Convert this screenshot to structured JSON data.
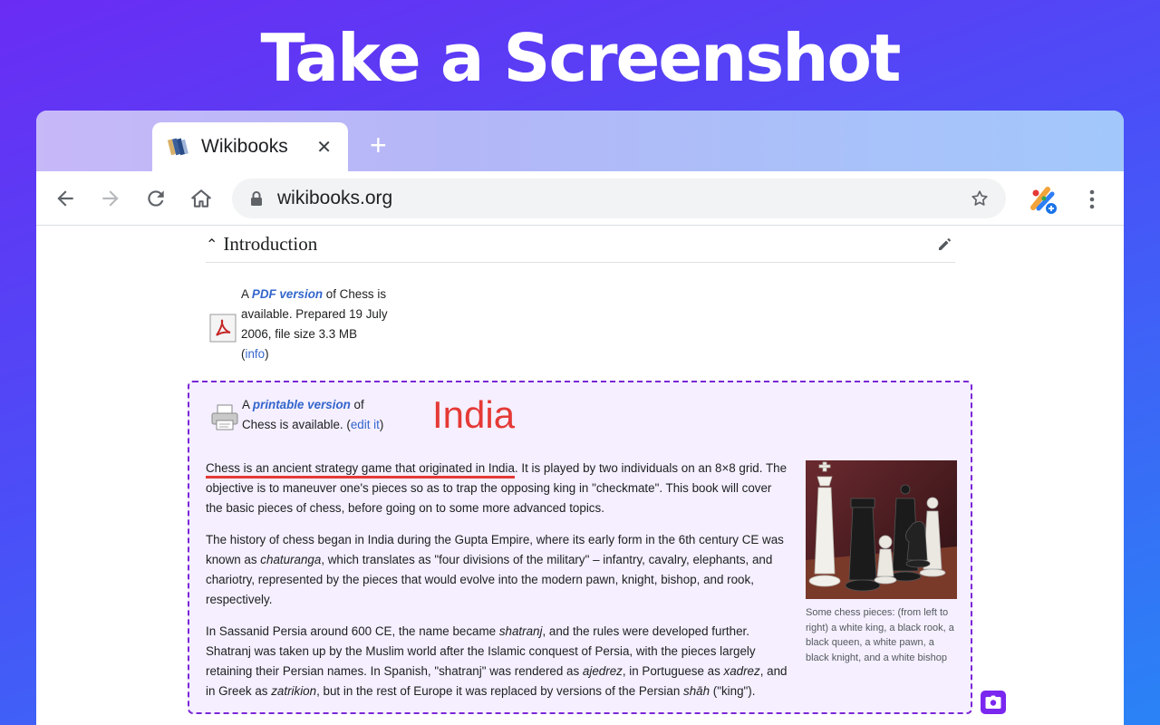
{
  "headline": "Take a Screenshot",
  "browser": {
    "tab": {
      "title": "Wikibooks",
      "close_label": "✕"
    },
    "new_tab_label": "+",
    "omnibox": {
      "url": "wikibooks.org"
    }
  },
  "page": {
    "section_title": "Introduction",
    "pdf": {
      "prefix": "A ",
      "link": "PDF version",
      "line1_rest": " of Chess is",
      "line2": "available. Prepared 19 July",
      "line3": "2006, file size 3.3 MB",
      "info_open": "(",
      "info_link": "info",
      "info_close": ")"
    },
    "printable": {
      "prefix": "A ",
      "link": "printable version",
      "line1_rest": " of",
      "line2": "Chess is available. (",
      "edit_link": "edit it",
      "edit_close": ")"
    },
    "annotation": "India",
    "para1_highlight": "Chess is an ancient strategy game that originated in India",
    "para1_rest": ". It is played by two individuals on an 8×8 grid. The objective is to maneuver one's pieces so as to trap the opposing king in \"checkmate\". This book will cover the basic pieces of chess, before going on to some more advanced topics.",
    "para2_a": "The history of chess began in India during the Gupta Empire, where its early form in the 6th century CE was known as ",
    "para2_i": "chaturanga",
    "para2_b": ", which translates as \"four divisions of the military\" – infantry, cavalry, elephants, and chariotry, represented by the pieces that would evolve into the modern pawn, knight, bishop, and rook, respectively.",
    "para3_a": "In Sassanid Persia around 600 CE, the name became ",
    "para3_i1": "shatranj",
    "para3_b": ", and the rules were developed further. Shatranj was taken up by the Muslim world after the Islamic conquest of Persia, with the pieces largely retaining their Persian names. In Spanish, \"shatranj\" was rendered as ",
    "para3_i2": "ajedrez",
    "para3_c": ", in Portuguese as ",
    "para3_i3": "xadrez",
    "para3_d": ", and in Greek as ",
    "para3_i4": "zatrikion",
    "para3_e": ", but in the rest of Europe it was replaced by versions of the Persian ",
    "para3_i5": "shāh",
    "para3_f": " (\"king\").",
    "figure_caption": "Some chess pieces: (from left to right) a white king, a black rook, a black queen, a white pawn, a black knight, and a white bishop"
  },
  "colors": {
    "selection_border": "#7a27d6",
    "annotation": "#e53935",
    "link": "#3366cc"
  }
}
